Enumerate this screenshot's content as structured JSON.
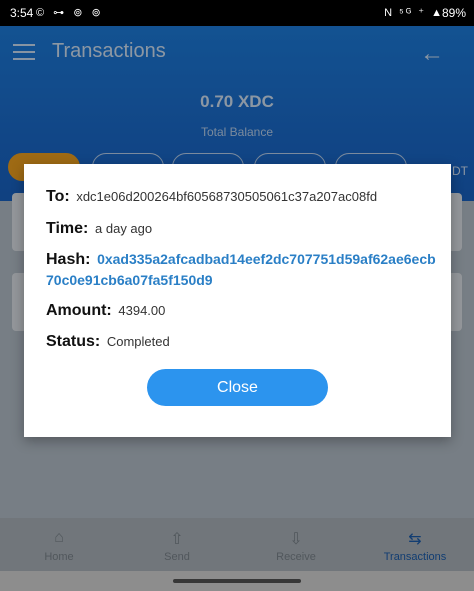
{
  "status_bar": {
    "time": "3:54",
    "notif_icons": "© ⊶ ⊚ ⊚",
    "right_icons": "N ⁵ᴳ ⁺ ▲",
    "battery": "89%"
  },
  "header": {
    "title": "Transactions",
    "balance_value": "0.70 XDC",
    "balance_label": "Total Balance",
    "chip_partial_label": "DT"
  },
  "dialog": {
    "to_label": "To:",
    "to_value": "xdc1e06d200264bf60568730505061c37a207ac08fd",
    "time_label": "Time:",
    "time_value": "a day ago",
    "hash_label": "Hash:",
    "hash_value": "0xad335a2afcadbad14eef2dc707751d59af62ae6ecb70c0e91cb6a07fa5f150d9",
    "amount_label": "Amount:",
    "amount_value": "4394.00",
    "status_label": "Status:",
    "status_value": "Completed",
    "close_label": "Close"
  },
  "bottom_nav": {
    "items": [
      {
        "label": "Home",
        "icon": "home-icon"
      },
      {
        "label": "Send",
        "icon": "send-icon"
      },
      {
        "label": "Receive",
        "icon": "receive-icon"
      },
      {
        "label": "Transactions",
        "icon": "transactions-icon"
      }
    ],
    "active_index": 3
  },
  "colors": {
    "header": "#1e7fe0",
    "accent_chip": "#f3a320",
    "hash_link": "#2a7fc6",
    "close_button": "#2c94ee"
  }
}
